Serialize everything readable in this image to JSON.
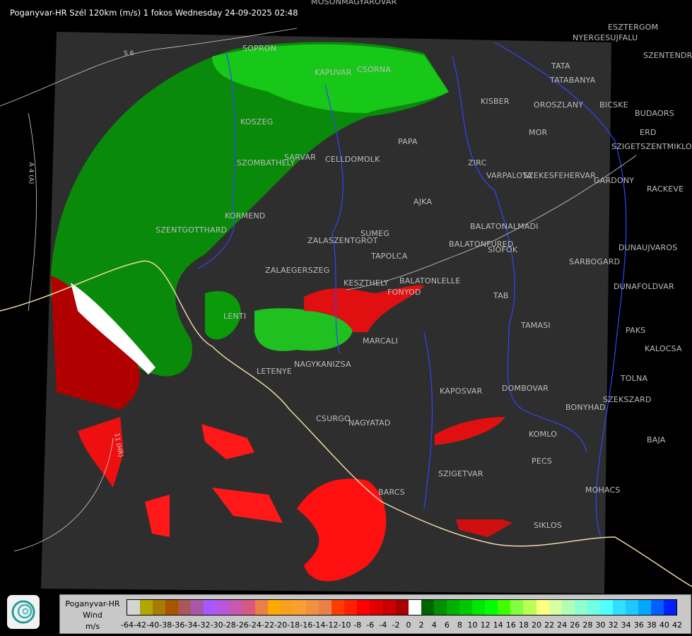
{
  "title": "Poganyvar-HR Szél 120km (m/s) 1 fokos Wednesday 24-09-2025 02:48",
  "legend": {
    "station": "Poganyvar-HR",
    "quantity": "Wind",
    "unit": "m/s",
    "colors": [
      "#d4d4d4",
      "#b0a800",
      "#a87c00",
      "#a85400",
      "#a85858",
      "#a858a8",
      "#a858ff",
      "#b858d8",
      "#c858b0",
      "#d85880",
      "#e88048",
      "#ffa800",
      "#f8a020",
      "#f8a030",
      "#f09040",
      "#e88048",
      "#ff3c00",
      "#ff2000",
      "#ff0000",
      "#e00000",
      "#c80000",
      "#a80000",
      "#ffffff",
      "#006400",
      "#009000",
      "#00b000",
      "#00c800",
      "#00e800",
      "#00ff00",
      "#40ff00",
      "#80ff40",
      "#b8ff58",
      "#ffff80",
      "#d8ffa0",
      "#b0ffb8",
      "#90ffd0",
      "#70ffe0",
      "#50ffff",
      "#30e0ff",
      "#20c8ff",
      "#00a8ff",
      "#0060ff",
      "#0020ff"
    ],
    "ticks": [
      "-64",
      "-42",
      "-40",
      "-38",
      "-36",
      "-34",
      "-32",
      "-30",
      "-28",
      "-26",
      "-24",
      "-22",
      "-20",
      "-18",
      "-16",
      "-14",
      "-12",
      "-10",
      "-8",
      "-6",
      "-4",
      "-2",
      "0",
      "2",
      "4",
      "6",
      "8",
      "10",
      "12",
      "14",
      "16",
      "18",
      "20",
      "22",
      "24",
      "26",
      "28",
      "30",
      "32",
      "34",
      "36",
      "38",
      "40",
      "42"
    ]
  },
  "roads": [
    "S 6",
    "A 4 (A)",
    "11 (HR)"
  ],
  "cities": [
    "MOSONMAGYAROVAR",
    "SOPRON",
    "KAPUVAR",
    "CSORNA",
    "KISBER",
    "TATA",
    "TATABANYA",
    "OROSZLANY",
    "BICSKE",
    "ESZTERGOM",
    "NYERGESUJFALU",
    "SZENTENDRE",
    "BUDAORS",
    "ERD",
    "SZIGETSZENTMIKLOS",
    "MOR",
    "PAPA",
    "ZIRC",
    "VARPALOTA",
    "SZEKESFEHERVAR",
    "GARDONY",
    "RACKEVE",
    "SARVAR",
    "CELLDOMOLK",
    "SZOMBATHELY",
    "KOSZEG",
    "AJKA",
    "KORMEND",
    "SZENTGOTTHARD",
    "SUMEG",
    "ZALASZENTGROT",
    "BALATONALMADI",
    "BALATONFURED",
    "SIOFOK",
    "TAPOLCA",
    "ZALAEGERSZEG",
    "KESZTHELY",
    "BALATONLELLE",
    "FONYOD",
    "TAB",
    "DUNAUJVAROS",
    "SARBOGARD",
    "DUNAFOLDVAR",
    "LENTI",
    "MARCALI",
    "TAMASI",
    "PAKS",
    "KALOCSA",
    "NAGYKANIZSA",
    "LETENYE",
    "TOLNA",
    "KAPOSVAR",
    "DOMBOVAR",
    "SZEKSZARD",
    "BONYHAD",
    "CSURGO",
    "NAGYATAD",
    "KOMLO",
    "BAJA",
    "PECS",
    "SZIGETVAR",
    "MOHACS",
    "BARCS",
    "SIKLOS"
  ]
}
